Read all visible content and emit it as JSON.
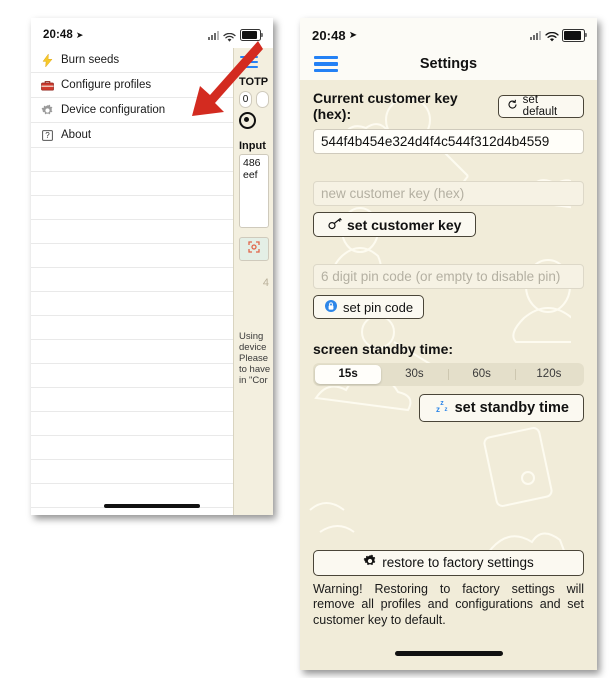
{
  "left_phone": {
    "status": {
      "time": "20:48",
      "location_arrow": "➤",
      "signal_icon": "cellular-signal-icon",
      "wifi_icon": "wifi-icon",
      "battery_icon": "battery-icon"
    },
    "menu_items": [
      {
        "label": "Burn seeds",
        "icon": "lightning-bolt-icon",
        "glyph": "⚡"
      },
      {
        "label": "Configure profiles",
        "icon": "toolbox-icon",
        "glyph": "🧰"
      },
      {
        "label": "Device configuration",
        "icon": "gear-icon",
        "glyph": "⚙"
      },
      {
        "label": "About",
        "icon": "question-box-icon",
        "glyph": "?"
      }
    ],
    "blank_rows": 14,
    "totp_strip": {
      "hamburger_icon": "hamburger-menu-icon",
      "title": "TOTP",
      "pill_value": "0",
      "radio_icon": "radio-selected-icon",
      "input_label": "Input",
      "input_value": "486\neef",
      "scan_icon": "qr-scan-icon",
      "glyph": "4",
      "note": "Using\ndevice\nPlease\nto have\nin \"Cor"
    }
  },
  "arrow": {
    "name": "pointer-arrow-annotation",
    "color": "#d32b20"
  },
  "right_phone": {
    "status": {
      "time": "20:48",
      "signal_icon": "cellular-signal-icon",
      "wifi_icon": "wifi-icon",
      "battery_icon": "battery-icon"
    },
    "navbar": {
      "menu_icon": "hamburger-menu-icon",
      "title": "Settings"
    },
    "current_key": {
      "label": "Current customer key (hex):",
      "set_default_label": "set default",
      "set_default_icon": "reset-arrow-icon",
      "value": "544f4b454e324d4f4c544f312d4b4559"
    },
    "new_key": {
      "placeholder": "new customer key (hex)",
      "value": "",
      "button_label": "set customer key",
      "button_icon": "key-icon"
    },
    "pin": {
      "placeholder": "6 digit pin code (or empty to disable pin)",
      "value": "",
      "button_label": "set pin code",
      "button_icon": "lock-circle-icon"
    },
    "standby": {
      "label": "screen standby time:",
      "options": [
        "15s",
        "30s",
        "60s",
        "120s"
      ],
      "selected": "15s",
      "button_label": "set standby time",
      "button_icon": "sleep-zzz-icon"
    },
    "factory": {
      "button_label": "restore to factory settings",
      "button_icon": "gear-warning-icon",
      "warning": "Warning! Restoring to factory settings will remove all profiles and configurations and set customer key to default."
    }
  },
  "colors": {
    "accent_blue": "#2481f5",
    "arrow_red": "#d32b20",
    "paper": "#f1ecd9",
    "button_face": "#fbf9f1"
  }
}
